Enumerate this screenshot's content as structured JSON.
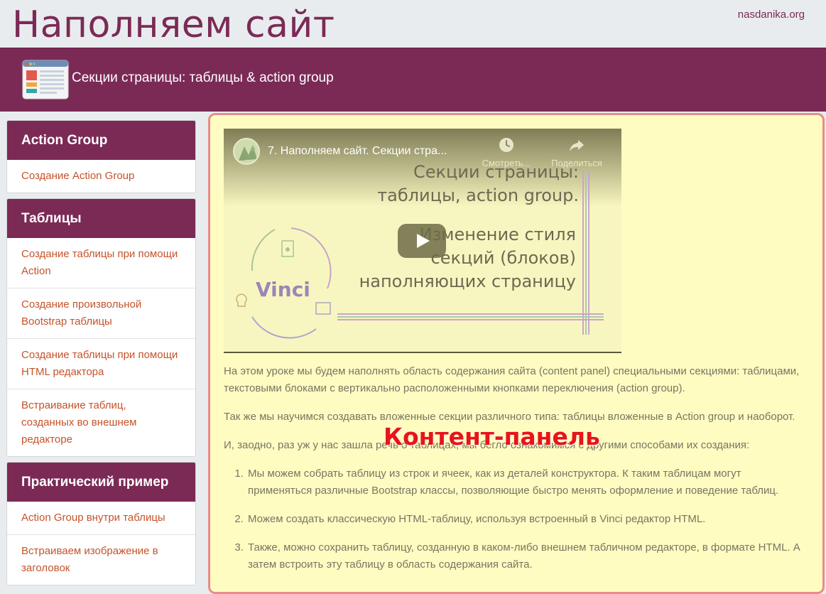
{
  "header": {
    "site_title": "Наполняем сайт",
    "site_link": "nasdanika.org"
  },
  "banner": {
    "title": "Секции страницы: таблицы & action group",
    "icon": "web-page-icon"
  },
  "sidebar": {
    "sections": [
      {
        "title": "Action Group",
        "items": [
          "Создание Action Group"
        ]
      },
      {
        "title": "Таблицы",
        "items": [
          "Создание таблицы при помощи Action",
          "Создание произвольной Bootstrap таблицы",
          "Создание таблицы при помощи HTML редактора",
          "Встраивание таблиц, созданных во внешнем редакторе"
        ]
      },
      {
        "title": "Практический пример",
        "items": [
          "Action Group внутри таблицы",
          "Встраиваем изображение в заголовок"
        ]
      }
    ]
  },
  "video": {
    "title": "7. Наполняем сайт. Секции стра...",
    "watch_later_label": "Смотреть...",
    "share_label": "Поделиться",
    "slide_line1": "Секции страницы:",
    "slide_line2": "таблицы, action group.",
    "slide_line3": "Изменение стиля",
    "slide_line4": "секций (блоков)",
    "slide_line5": "наполняющих страницу",
    "logo_text": "Vinci"
  },
  "content": {
    "paragraphs": [
      "На этом уроке мы будем наполнять область содержания сайта (content panel) специальными секциями: таблицами, текстовыми блоками с вертикально расположенными кнопками переключения (action group).",
      "Так же мы научимся создавать вложенные секции различного типа: таблицы вложенные в Action group и наоборот.",
      "И, заодно, раз уж у нас зашла речь о таблицах, мы бегло ознакомимся с другими способами их создания:"
    ],
    "list": [
      "Мы можем собрать таблицу из строк и ячеек, как из деталей конструктора. К таким таблицам могут применяться различные Bootstrap классы, позволяющие быстро менять оформление и поведение таблиц.",
      "Можем создать классическую HTML-таблицу, используя встроенный в Vinci редактор HTML.",
      "Также, можно сохранить таблицу, созданную в каком-либо внешнем табличном редакторе, в формате HTML. А затем встроить эту таблицу в область содержания сайта."
    ],
    "overlay_label": "Контент-панель"
  },
  "colors": {
    "brand": "#7b2a56",
    "link": "#c5532a",
    "content_bg": "#fffcc2",
    "content_border": "#eb8b8b",
    "overlay": "#e8141a"
  }
}
